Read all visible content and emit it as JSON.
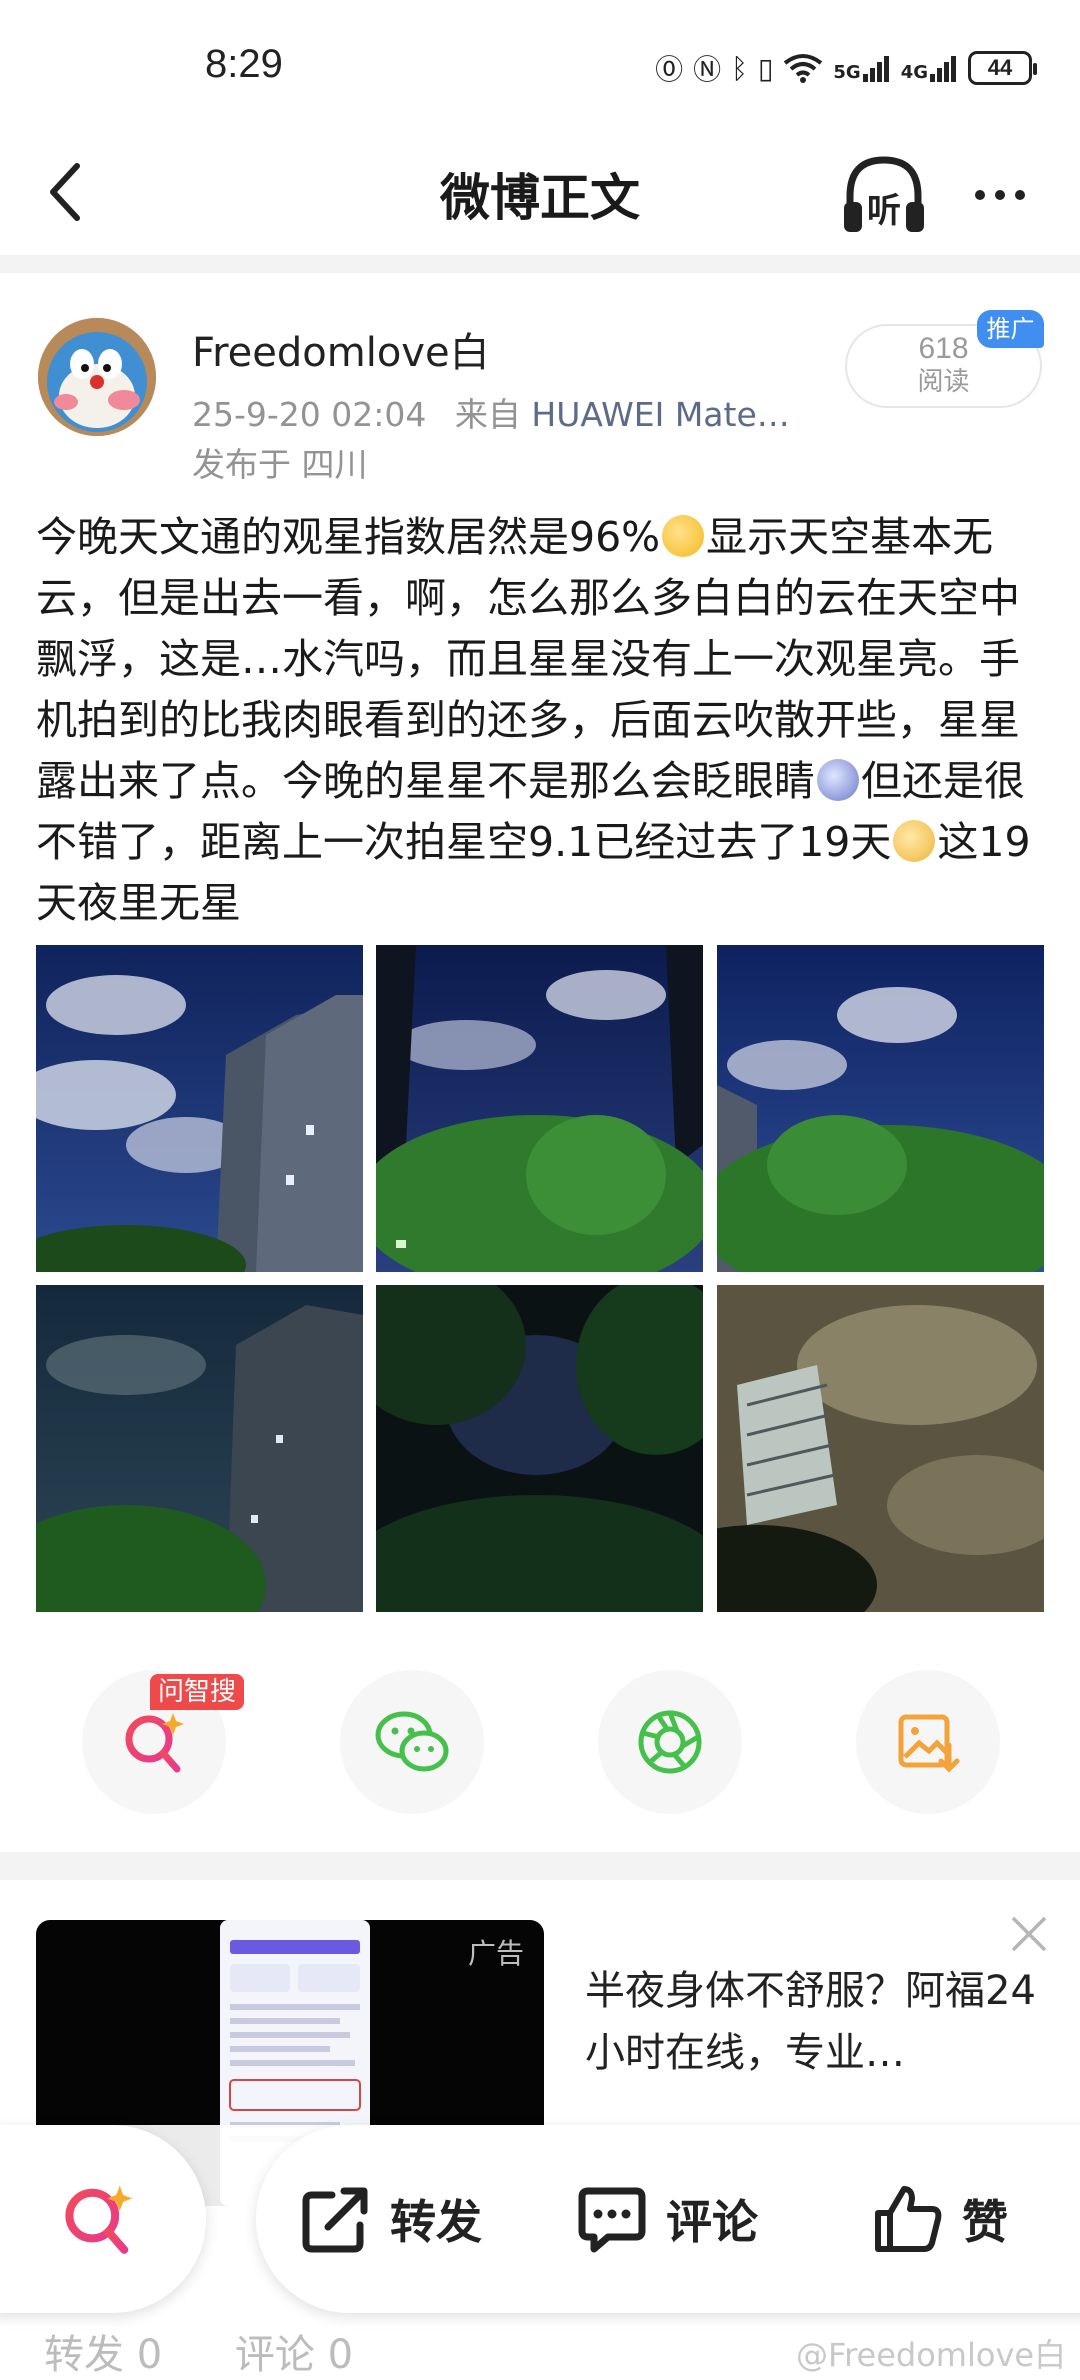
{
  "status_bar": {
    "time": "8:29",
    "network_5g": "5G",
    "network_4g": "4G",
    "battery": "44"
  },
  "nav": {
    "title": "微博正文",
    "listen_label": "听"
  },
  "author": {
    "name": "Freedomlove白",
    "timestamp": "25-9-20 02:04",
    "source_prefix": "来自",
    "device": "HUAWEI Mate…",
    "location": "发布于 四川",
    "read_count": "618",
    "read_label": "阅读",
    "promo_label": "推广"
  },
  "post": {
    "text_1": "今晚天文通的观星指数居然是96%",
    "text_2": "显示天空基本无云，但是出去一看，啊，怎么那么多白白的云在天空中飘浮，这是…水汽吗，而且星星没有上一次观星亮。手机拍到的比我肉眼看到的还多，后面云吹散开些，星星露出来了点。今晚的星星不是那么会眨眼睛",
    "text_3": "但还是很不错了，距离上一次拍星空9.1已经过去了19天",
    "text_4": "这19天夜里无星"
  },
  "actions": {
    "ai_search_tag": "问智搜",
    "items": [
      "ai-search-icon",
      "wechat-icon",
      "moments-icon",
      "save-image-icon"
    ]
  },
  "ad": {
    "label": "广告",
    "headline": "半夜身体不舒服？阿福24小时在线，专业…"
  },
  "bottom_bar": {
    "repost_label": "转发",
    "comment_label": "评论",
    "like_label": "赞"
  },
  "stats": {
    "repost": "转发 0",
    "comment": "评论 0"
  },
  "watermark": "@Freedomlove白",
  "colors": {
    "link_blue": "#5b6b89",
    "promo_blue": "#3f8ef0",
    "ai_tag_red": "#ef4a4a",
    "wechat_green": "#44c04b",
    "save_orange": "#f2a33a"
  }
}
